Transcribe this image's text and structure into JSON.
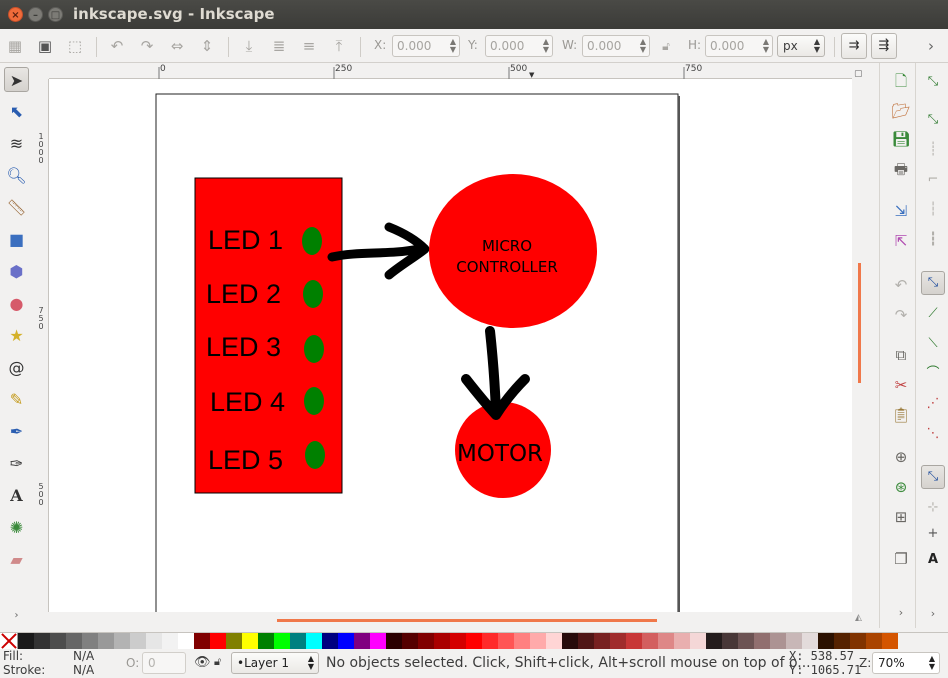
{
  "window": {
    "title": "inkscape.svg - Inkscape",
    "close_glyph": "×",
    "min_glyph": "–",
    "max_glyph": "□"
  },
  "toolbar": {
    "x_label": "X:",
    "x_value": "0.000",
    "y_label": "Y:",
    "y_value": "0.000",
    "w_label": "W:",
    "w_value": "0.000",
    "h_label": "H:",
    "h_value": "0.000",
    "unit": "px",
    "icons": [
      "select-all-icon",
      "select-all-in-all-layers-icon",
      "deselect-icon",
      "rotate-ccw-icon",
      "rotate-cw-icon",
      "flip-horizontal-icon",
      "flip-vertical-icon",
      "lower-to-bottom-icon",
      "lower-icon",
      "raise-icon",
      "raise-to-top-icon",
      "lock-ratio-icon"
    ]
  },
  "rulers": {
    "h_ticks": [
      "0",
      "250",
      "500",
      "750"
    ],
    "v_ticks": [
      "1000",
      "750",
      "500"
    ]
  },
  "diagram": {
    "leds": [
      "LED 1",
      "LED 2",
      "LED 3",
      "LED 4",
      "LED 5"
    ],
    "controller_line1": "MICRO",
    "controller_line2": "CONTROLLER",
    "motor": "MOTOR",
    "colors": {
      "panel": "#ff0000",
      "led": "#008000",
      "arrow": "#000000"
    }
  },
  "palette": [
    "#1a1a1a",
    "#333333",
    "#4d4d4d",
    "#666666",
    "#808080",
    "#999999",
    "#b3b3b3",
    "#cccccc",
    "#e6e6e6",
    "#f2f2f2",
    "#ffffff",
    "#800000",
    "#ff0000",
    "#808000",
    "#ffff00",
    "#008000",
    "#00ff00",
    "#008080",
    "#00ffff",
    "#000080",
    "#0000ff",
    "#800080",
    "#ff00ff",
    "#2b0000",
    "#550000",
    "#800000",
    "#aa0000",
    "#d40000",
    "#ff0000",
    "#ff2a2a",
    "#ff5555",
    "#ff8080",
    "#ffaaaa",
    "#ffd5d5",
    "#280b0b",
    "#501616",
    "#782121",
    "#a02c2c",
    "#c83737",
    "#d35f5f",
    "#de8787",
    "#e9afaf",
    "#f4d7d7",
    "#241c1c",
    "#483737",
    "#6c5353",
    "#916f6f",
    "#ac9393",
    "#c8b7b7",
    "#e3dbdb",
    "#2b1100",
    "#552200",
    "#803300",
    "#aa4400",
    "#d45500"
  ],
  "status": {
    "fill_label": "Fill:",
    "fill_value": "N/A",
    "stroke_label": "Stroke:",
    "stroke_value": "N/A",
    "opacity_label": "O:",
    "opacity_value": "0",
    "layer": "•Layer 1",
    "message": "No objects selected. Click, Shift+click, Alt+scroll mouse on top of o...",
    "x_coord": "X:  538.57",
    "y_coord": "Y: 1065.71",
    "zoom_label": "Z:",
    "zoom_value": "70%"
  }
}
